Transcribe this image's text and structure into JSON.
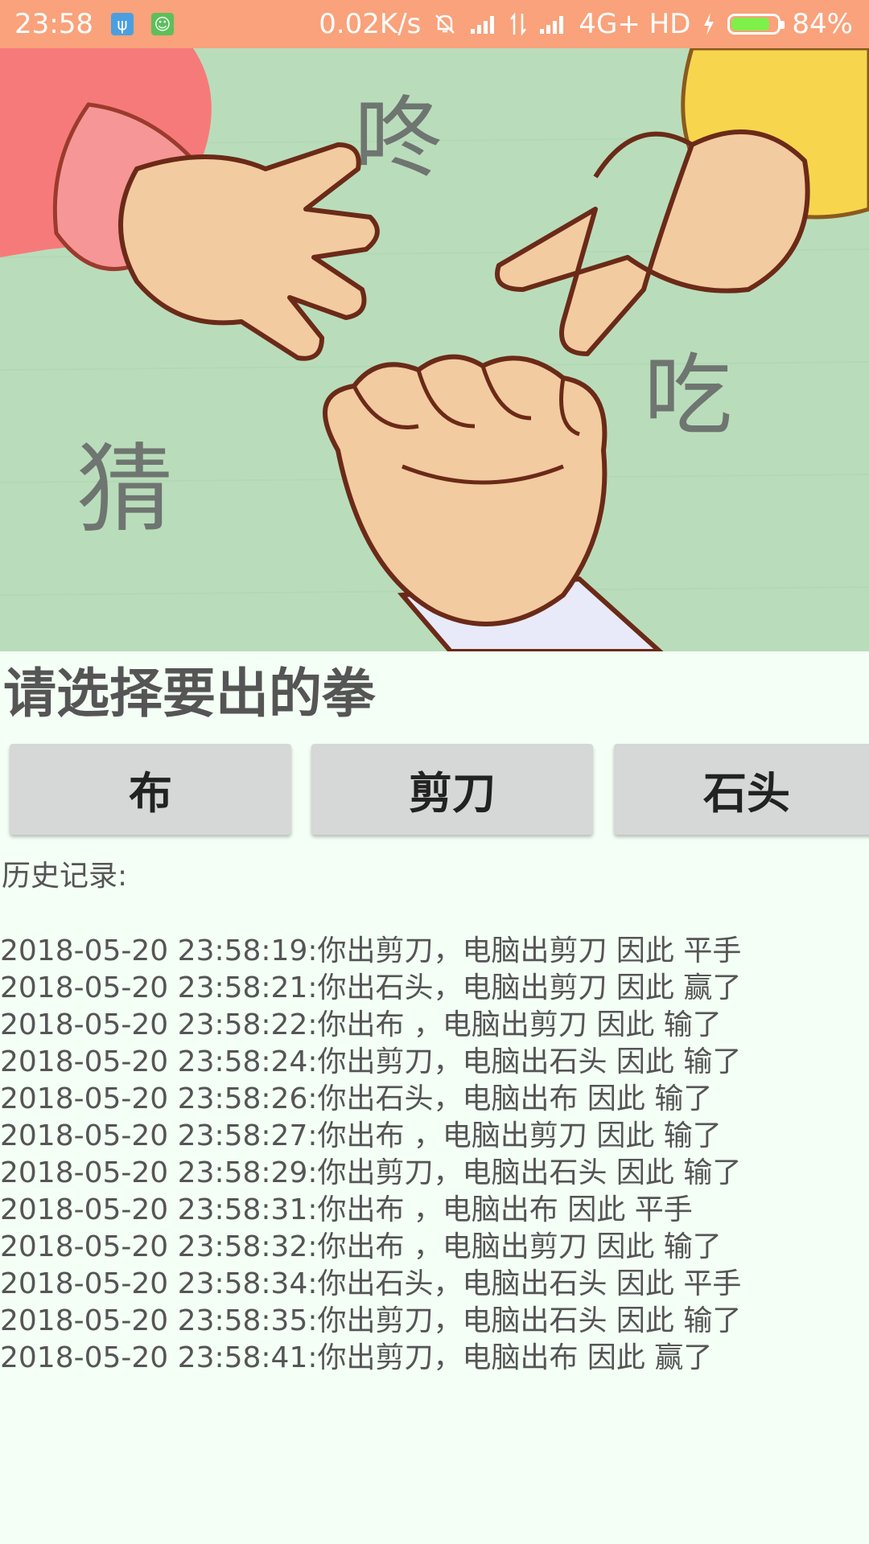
{
  "status_bar": {
    "time": "23:58",
    "net_speed": "0.02K/s",
    "network": "4G+ HD",
    "battery_percent": "84%",
    "battery_level": 0.84,
    "icons": [
      "usb-icon",
      "android-bot-icon",
      "mute-bell-icon",
      "signal-icon",
      "data-transfer-icon",
      "signal-icon",
      "charging-icon",
      "battery-icon"
    ]
  },
  "hero": {
    "char_1": "咚",
    "char_2": "吃",
    "char_3": "猜"
  },
  "prompt": "请选择要出的拳",
  "choices": [
    {
      "label": "布"
    },
    {
      "label": "剪刀"
    },
    {
      "label": "石头"
    }
  ],
  "history": {
    "label": "历史记录:",
    "entries": [
      "2018-05-20 23:58:19:你出剪刀，电脑出剪刀 因此 平手",
      "2018-05-20 23:58:21:你出石头，电脑出剪刀 因此 赢了",
      "2018-05-20 23:58:22:你出布 ，电脑出剪刀 因此 输了",
      "2018-05-20 23:58:24:你出剪刀，电脑出石头 因此 输了",
      "2018-05-20 23:58:26:你出石头，电脑出布  因此 输了",
      "2018-05-20 23:58:27:你出布 ，电脑出剪刀 因此 输了",
      "2018-05-20 23:58:29:你出剪刀，电脑出石头 因此 输了",
      "2018-05-20 23:58:31:你出布 ，电脑出布  因此 平手",
      "2018-05-20 23:58:32:你出布 ，电脑出剪刀 因此 输了",
      "2018-05-20 23:58:34:你出石头，电脑出石头 因此 平手",
      "2018-05-20 23:58:35:你出剪刀，电脑出石头 因此 输了",
      "2018-05-20 23:58:41:你出剪刀，电脑出布  因此 赢了"
    ]
  }
}
